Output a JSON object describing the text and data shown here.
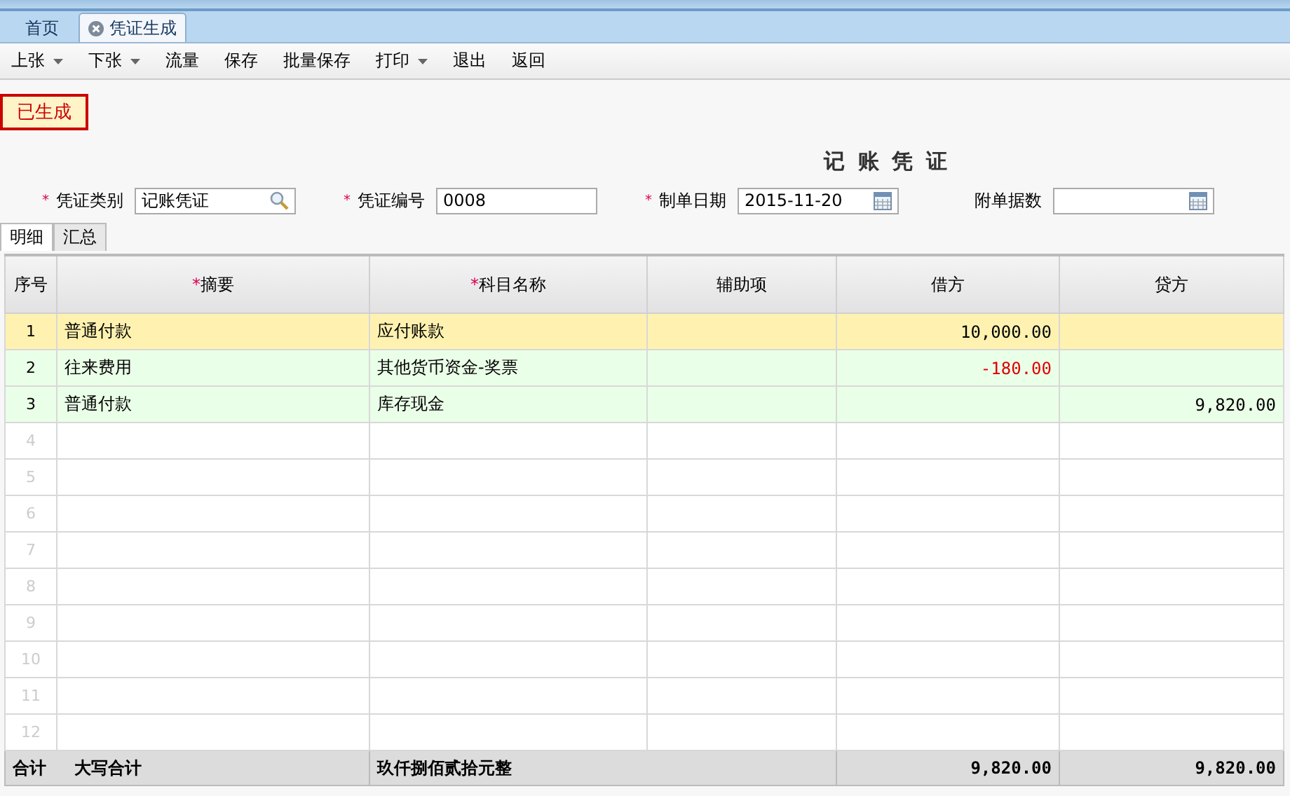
{
  "tabs": [
    {
      "label": "首页",
      "closable": false,
      "selected": false
    },
    {
      "label": "凭证生成",
      "closable": true,
      "selected": true
    }
  ],
  "toolbar": [
    {
      "label": "上张",
      "dropdown": true
    },
    {
      "label": "下张",
      "dropdown": true
    },
    {
      "label": "流量",
      "dropdown": false
    },
    {
      "label": "保存",
      "dropdown": false
    },
    {
      "label": "批量保存",
      "dropdown": false
    },
    {
      "label": "打印",
      "dropdown": true
    },
    {
      "label": "退出",
      "dropdown": false
    },
    {
      "label": "返回",
      "dropdown": false
    }
  ],
  "status_badge": "已生成",
  "voucher_title": "记 账 凭 证",
  "fields": [
    {
      "mark": "*",
      "label": "凭证类别",
      "value": "记账凭证"
    },
    {
      "mark": "*",
      "label": "凭证编号",
      "value": "0008"
    },
    {
      "mark": "*",
      "label": "制单日期",
      "value": "2015-11-20"
    },
    {
      "label": "附单据数"
    }
  ],
  "subtabs": [
    {
      "label": "明细",
      "selected": true
    },
    {
      "label": "汇总",
      "selected": false
    }
  ],
  "table": {
    "columns": [
      {
        "label": "序号"
      },
      {
        "mark": "*",
        "label": "摘要"
      },
      {
        "mark": "*",
        "label": "科目名称"
      },
      {
        "label": "辅助项"
      },
      {
        "label": "借方"
      },
      {
        "label": "贷方"
      }
    ],
    "rows": [
      {
        "kind": "entry",
        "index": "1",
        "summary": "普通付款",
        "account": "应付账款",
        "debit": "10,000.00",
        "negative": false,
        "selected": true
      },
      {
        "kind": "entry",
        "index": "2",
        "summary": "往来费用",
        "account": "其他货币资金-奖票",
        "debit": "-180.00",
        "negative": true,
        "selected": false
      },
      {
        "kind": "entry",
        "index": "3",
        "summary": "普通付款",
        "account": "库存现金",
        "credit": "9,820.00",
        "negative": false,
        "selected": false
      },
      {
        "kind": "blank",
        "index": "4",
        "selected": false
      },
      {
        "kind": "blank",
        "index": "5",
        "selected": false
      },
      {
        "kind": "blank",
        "index": "6",
        "selected": false
      },
      {
        "kind": "blank",
        "index": "7",
        "selected": false
      },
      {
        "kind": "blank",
        "index": "8",
        "selected": false
      },
      {
        "kind": "blank",
        "index": "9",
        "selected": false
      },
      {
        "kind": "blank",
        "index": "10",
        "selected": false
      },
      {
        "kind": "blank",
        "index": "11",
        "selected": false
      },
      {
        "kind": "blank",
        "index": "12",
        "selected": false
      }
    ],
    "total": {
      "label": "合计",
      "amount_label": "大写合计",
      "amount_words": "玖仟捌佰贰拾元整",
      "debit": "9,820.00",
      "credit": "9,820.00"
    }
  }
}
